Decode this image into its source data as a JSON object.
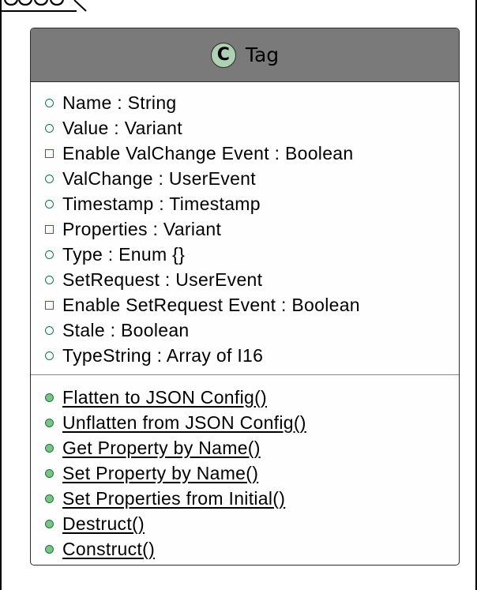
{
  "colors": {
    "header_bg": "#7a7a7a",
    "stereotype_circle": "#add1b2",
    "public_icon": "#038048",
    "public_method_fill": "#84be84",
    "private_icon": "#c82930",
    "box_border": "#2b2b2b"
  },
  "class": {
    "stereotype_letter": "C",
    "name": "Tag",
    "attributes": [
      {
        "visibility": "public",
        "text": "Name : String"
      },
      {
        "visibility": "public",
        "text": "Value : Variant"
      },
      {
        "visibility": "private",
        "text": "Enable ValChange Event : Boolean"
      },
      {
        "visibility": "public",
        "text": "ValChange : UserEvent"
      },
      {
        "visibility": "public",
        "text": "Timestamp : Timestamp"
      },
      {
        "visibility": "private",
        "text": "Properties : Variant"
      },
      {
        "visibility": "public",
        "text": "Type : Enum {}"
      },
      {
        "visibility": "public",
        "text": "SetRequest : UserEvent"
      },
      {
        "visibility": "private",
        "text": "Enable SetRequest Event : Boolean"
      },
      {
        "visibility": "public",
        "text": "Stale : Boolean"
      },
      {
        "visibility": "public",
        "text": "TypeString : Array of I16"
      }
    ],
    "methods": [
      {
        "visibility": "public",
        "text": "Flatten to JSON Config()"
      },
      {
        "visibility": "public",
        "text": "Unflatten from JSON Config()"
      },
      {
        "visibility": "public",
        "text": "Get Property by Name()"
      },
      {
        "visibility": "public",
        "text": "Set Property by Name()"
      },
      {
        "visibility": "public",
        "text": "Set Properties from Initial()"
      },
      {
        "visibility": "public",
        "text": "Destruct()"
      },
      {
        "visibility": "public",
        "text": "Construct()"
      }
    ]
  }
}
